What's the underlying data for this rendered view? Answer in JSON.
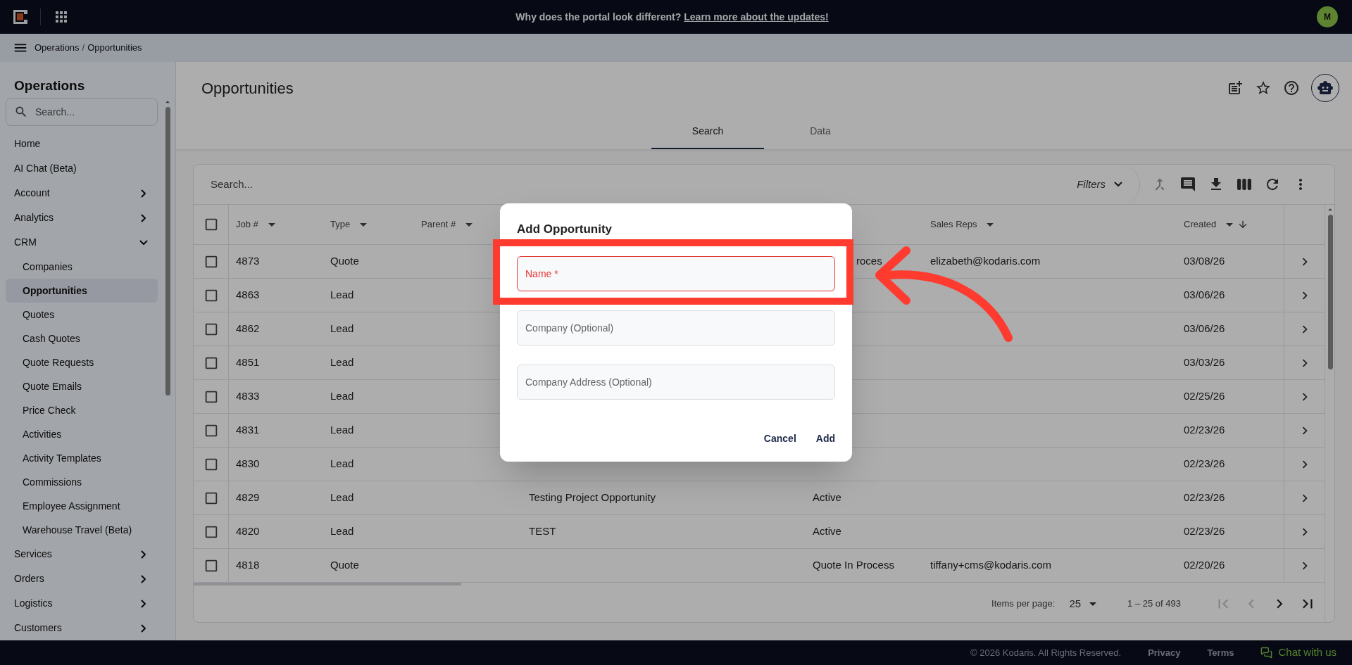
{
  "top_bar": {
    "announcement": "Why does the portal look different?",
    "link": "Learn more about the updates!",
    "avatar": "M"
  },
  "breadcrumb": {
    "items": [
      "Operations",
      "Opportunities"
    ],
    "separator": "/"
  },
  "sidebar": {
    "title": "Operations",
    "search_placeholder": "Search...",
    "items": [
      {
        "label": "Home",
        "kind": "link",
        "selected": false
      },
      {
        "label": "AI Chat (Beta)",
        "kind": "link",
        "selected": false
      },
      {
        "label": "Account",
        "kind": "group",
        "expanded": false
      },
      {
        "label": "Analytics",
        "kind": "group",
        "expanded": false
      },
      {
        "label": "CRM",
        "kind": "group",
        "expanded": true,
        "children": [
          {
            "label": "Companies",
            "selected": false
          },
          {
            "label": "Opportunities",
            "selected": true
          },
          {
            "label": "Quotes",
            "selected": false
          },
          {
            "label": "Cash Quotes",
            "selected": false
          },
          {
            "label": "Quote Requests",
            "selected": false
          },
          {
            "label": "Quote Emails",
            "selected": false
          },
          {
            "label": "Price Check",
            "selected": false
          },
          {
            "label": "Activities",
            "selected": false
          },
          {
            "label": "Activity Templates",
            "selected": false
          },
          {
            "label": "Commissions",
            "selected": false
          },
          {
            "label": "Employee Assignment",
            "selected": false
          },
          {
            "label": "Warehouse Travel (Beta)",
            "selected": false
          }
        ]
      },
      {
        "label": "Services",
        "kind": "group",
        "expanded": false
      },
      {
        "label": "Orders",
        "kind": "group",
        "expanded": false
      },
      {
        "label": "Logistics",
        "kind": "group",
        "expanded": false
      },
      {
        "label": "Customers",
        "kind": "group",
        "expanded": false
      }
    ]
  },
  "page": {
    "title": "Opportunities",
    "tabs": [
      {
        "label": "Search",
        "selected": true
      },
      {
        "label": "Data",
        "selected": false
      }
    ]
  },
  "table": {
    "search_placeholder": "Search...",
    "filters": "Filters",
    "select_all_checked": false,
    "columns": [
      {
        "label": "Job #",
        "sorted": false
      },
      {
        "label": "Type",
        "sorted": false
      },
      {
        "label": "Parent #",
        "sorted": false
      },
      {
        "label": "Sales Reps",
        "sorted": false
      },
      {
        "label": "Created",
        "sorted": true
      }
    ],
    "rows": [
      {
        "checked": false,
        "job": "4873",
        "type": "Quote",
        "status": "roces",
        "status_covered": true,
        "sales_rep": "elizabeth@kodaris.com",
        "created": "03/08/26"
      },
      {
        "checked": false,
        "job": "4863",
        "type": "Lead",
        "created": "03/06/26"
      },
      {
        "checked": false,
        "job": "4862",
        "type": "Lead",
        "created": "03/06/26"
      },
      {
        "checked": false,
        "job": "4851",
        "type": "Lead",
        "created": "03/03/26"
      },
      {
        "checked": false,
        "job": "4833",
        "type": "Lead",
        "created": "02/25/26"
      },
      {
        "checked": false,
        "job": "4831",
        "type": "Lead",
        "created": "02/23/26"
      },
      {
        "checked": false,
        "job": "4830",
        "type": "Lead",
        "created": "02/23/26"
      },
      {
        "checked": false,
        "job": "4829",
        "type": "Lead",
        "name": "Testing Project Opportunity",
        "status": "Active",
        "created": "02/23/26"
      },
      {
        "checked": false,
        "job": "4820",
        "type": "Lead",
        "name": "TEST",
        "status": "Active",
        "created": "02/23/26"
      },
      {
        "checked": false,
        "job": "4818",
        "type": "Quote",
        "status": "Quote In Process",
        "sales_rep": "tiffany+cms@kodaris.com",
        "created": "02/20/26"
      }
    ]
  },
  "pagination": {
    "label": "Items per page:",
    "page_size": "25",
    "range": "1 – 25 of 493",
    "buttons": [
      {
        "kind": "first",
        "disabled": true
      },
      {
        "kind": "prev",
        "disabled": true
      },
      {
        "kind": "next",
        "disabled": false
      },
      {
        "kind": "last",
        "disabled": false
      }
    ]
  },
  "footer": {
    "copyright": "© 2026 Kodaris. All Rights Reserved.",
    "links": [
      "Privacy",
      "Terms"
    ],
    "chat": "Chat with us"
  },
  "dialog": {
    "title": "Add Opportunity",
    "fields": [
      {
        "placeholder": "Name *",
        "invalid": true
      },
      {
        "placeholder": "Company (Optional)",
        "invalid": false
      },
      {
        "placeholder": "Company Address (Optional)",
        "invalid": false
      }
    ],
    "buttons": [
      "Cancel",
      "Add"
    ]
  }
}
